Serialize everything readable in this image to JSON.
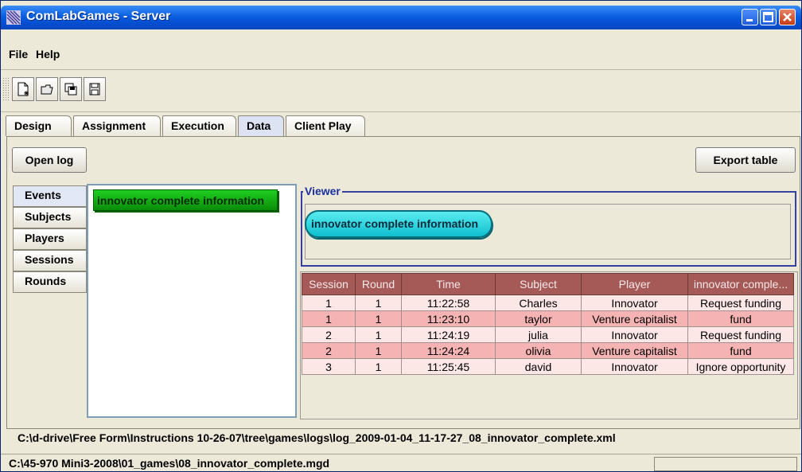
{
  "window": {
    "title": "ComLabGames - Server",
    "accent": "#0a5fe0"
  },
  "menu": {
    "file": "File",
    "help": "Help"
  },
  "toolbar": {
    "buttons": [
      {
        "icon": "new-document-icon"
      },
      {
        "icon": "open-folder-icon"
      },
      {
        "icon": "save-all-icon"
      },
      {
        "icon": "save-icon"
      }
    ]
  },
  "tabs": [
    "Design",
    "Assignment",
    "Execution",
    "Data",
    "Client Play"
  ],
  "active_tab": "Data",
  "actions": {
    "open_log": "Open log",
    "export_table": "Export table"
  },
  "side_tabs": [
    "Events",
    "Subjects",
    "Players",
    "Sessions",
    "Rounds"
  ],
  "events_list": [
    "innovator complete information"
  ],
  "viewer": {
    "label": "Viewer",
    "selected": "innovator complete information"
  },
  "table": {
    "headers": [
      "Session",
      "Round",
      "Time",
      "Subject",
      "Player",
      "innovator comple..."
    ],
    "rows": [
      [
        "1",
        "1",
        "11:22:58",
        "Charles",
        "Innovator",
        "Request funding"
      ],
      [
        "1",
        "1",
        "11:23:10",
        "taylor",
        "Venture capitalist",
        "fund"
      ],
      [
        "2",
        "1",
        "11:24:19",
        "julia",
        "Innovator",
        "Request funding"
      ],
      [
        "2",
        "1",
        "11:24:24",
        "olivia",
        "Venture capitalist",
        "fund"
      ],
      [
        "3",
        "1",
        "11:25:45",
        "david",
        "Innovator",
        "Ignore opportunity"
      ]
    ]
  },
  "log_path": "C:\\d-drive\\Free Form\\Instructions 10-26-07\\tree\\games\\logs\\log_2009-01-04_11-17-27_08_innovator_complete.xml",
  "status": {
    "path": "C:\\45-970 Mini3-2008\\01_games\\08_innovator_complete.mgd"
  }
}
